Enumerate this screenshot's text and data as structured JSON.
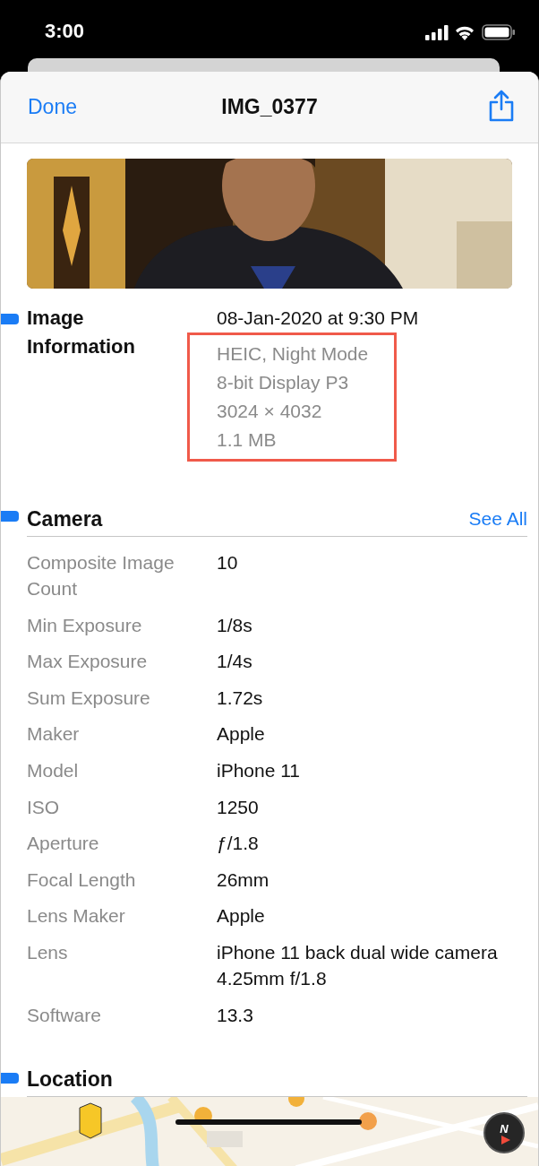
{
  "status_bar": {
    "time": "3:00"
  },
  "nav": {
    "done": "Done",
    "title": "IMG_0377"
  },
  "image_information": {
    "heading": "Image Information",
    "date": "08-Jan-2020 at 9:30 PM",
    "details": [
      "HEIC, Night Mode",
      "8-bit Display P3",
      "3024 × 4032",
      "1.1 MB"
    ],
    "highlighted": true
  },
  "camera": {
    "heading": "Camera",
    "see_all": "See All",
    "rows": [
      {
        "label": "Composite Image Count",
        "value": "10"
      },
      {
        "label": "Min Exposure",
        "value": "1/8s"
      },
      {
        "label": "Max Exposure",
        "value": "1/4s"
      },
      {
        "label": "Sum Exposure",
        "value": "1.72s"
      },
      {
        "label": "Maker",
        "value": "Apple"
      },
      {
        "label": "Model",
        "value": "iPhone 11"
      },
      {
        "label": "ISO",
        "value": "1250"
      },
      {
        "label": "Aperture",
        "value": "ƒ/1.8"
      },
      {
        "label": "Focal Length",
        "value": "26mm"
      },
      {
        "label": "Lens Maker",
        "value": "Apple"
      },
      {
        "label": "Lens",
        "value": "iPhone 11 back dual wide camera 4.25mm f/1.8"
      },
      {
        "label": "Software",
        "value": "13.3"
      }
    ]
  },
  "location": {
    "heading": "Location",
    "compass": "N"
  }
}
